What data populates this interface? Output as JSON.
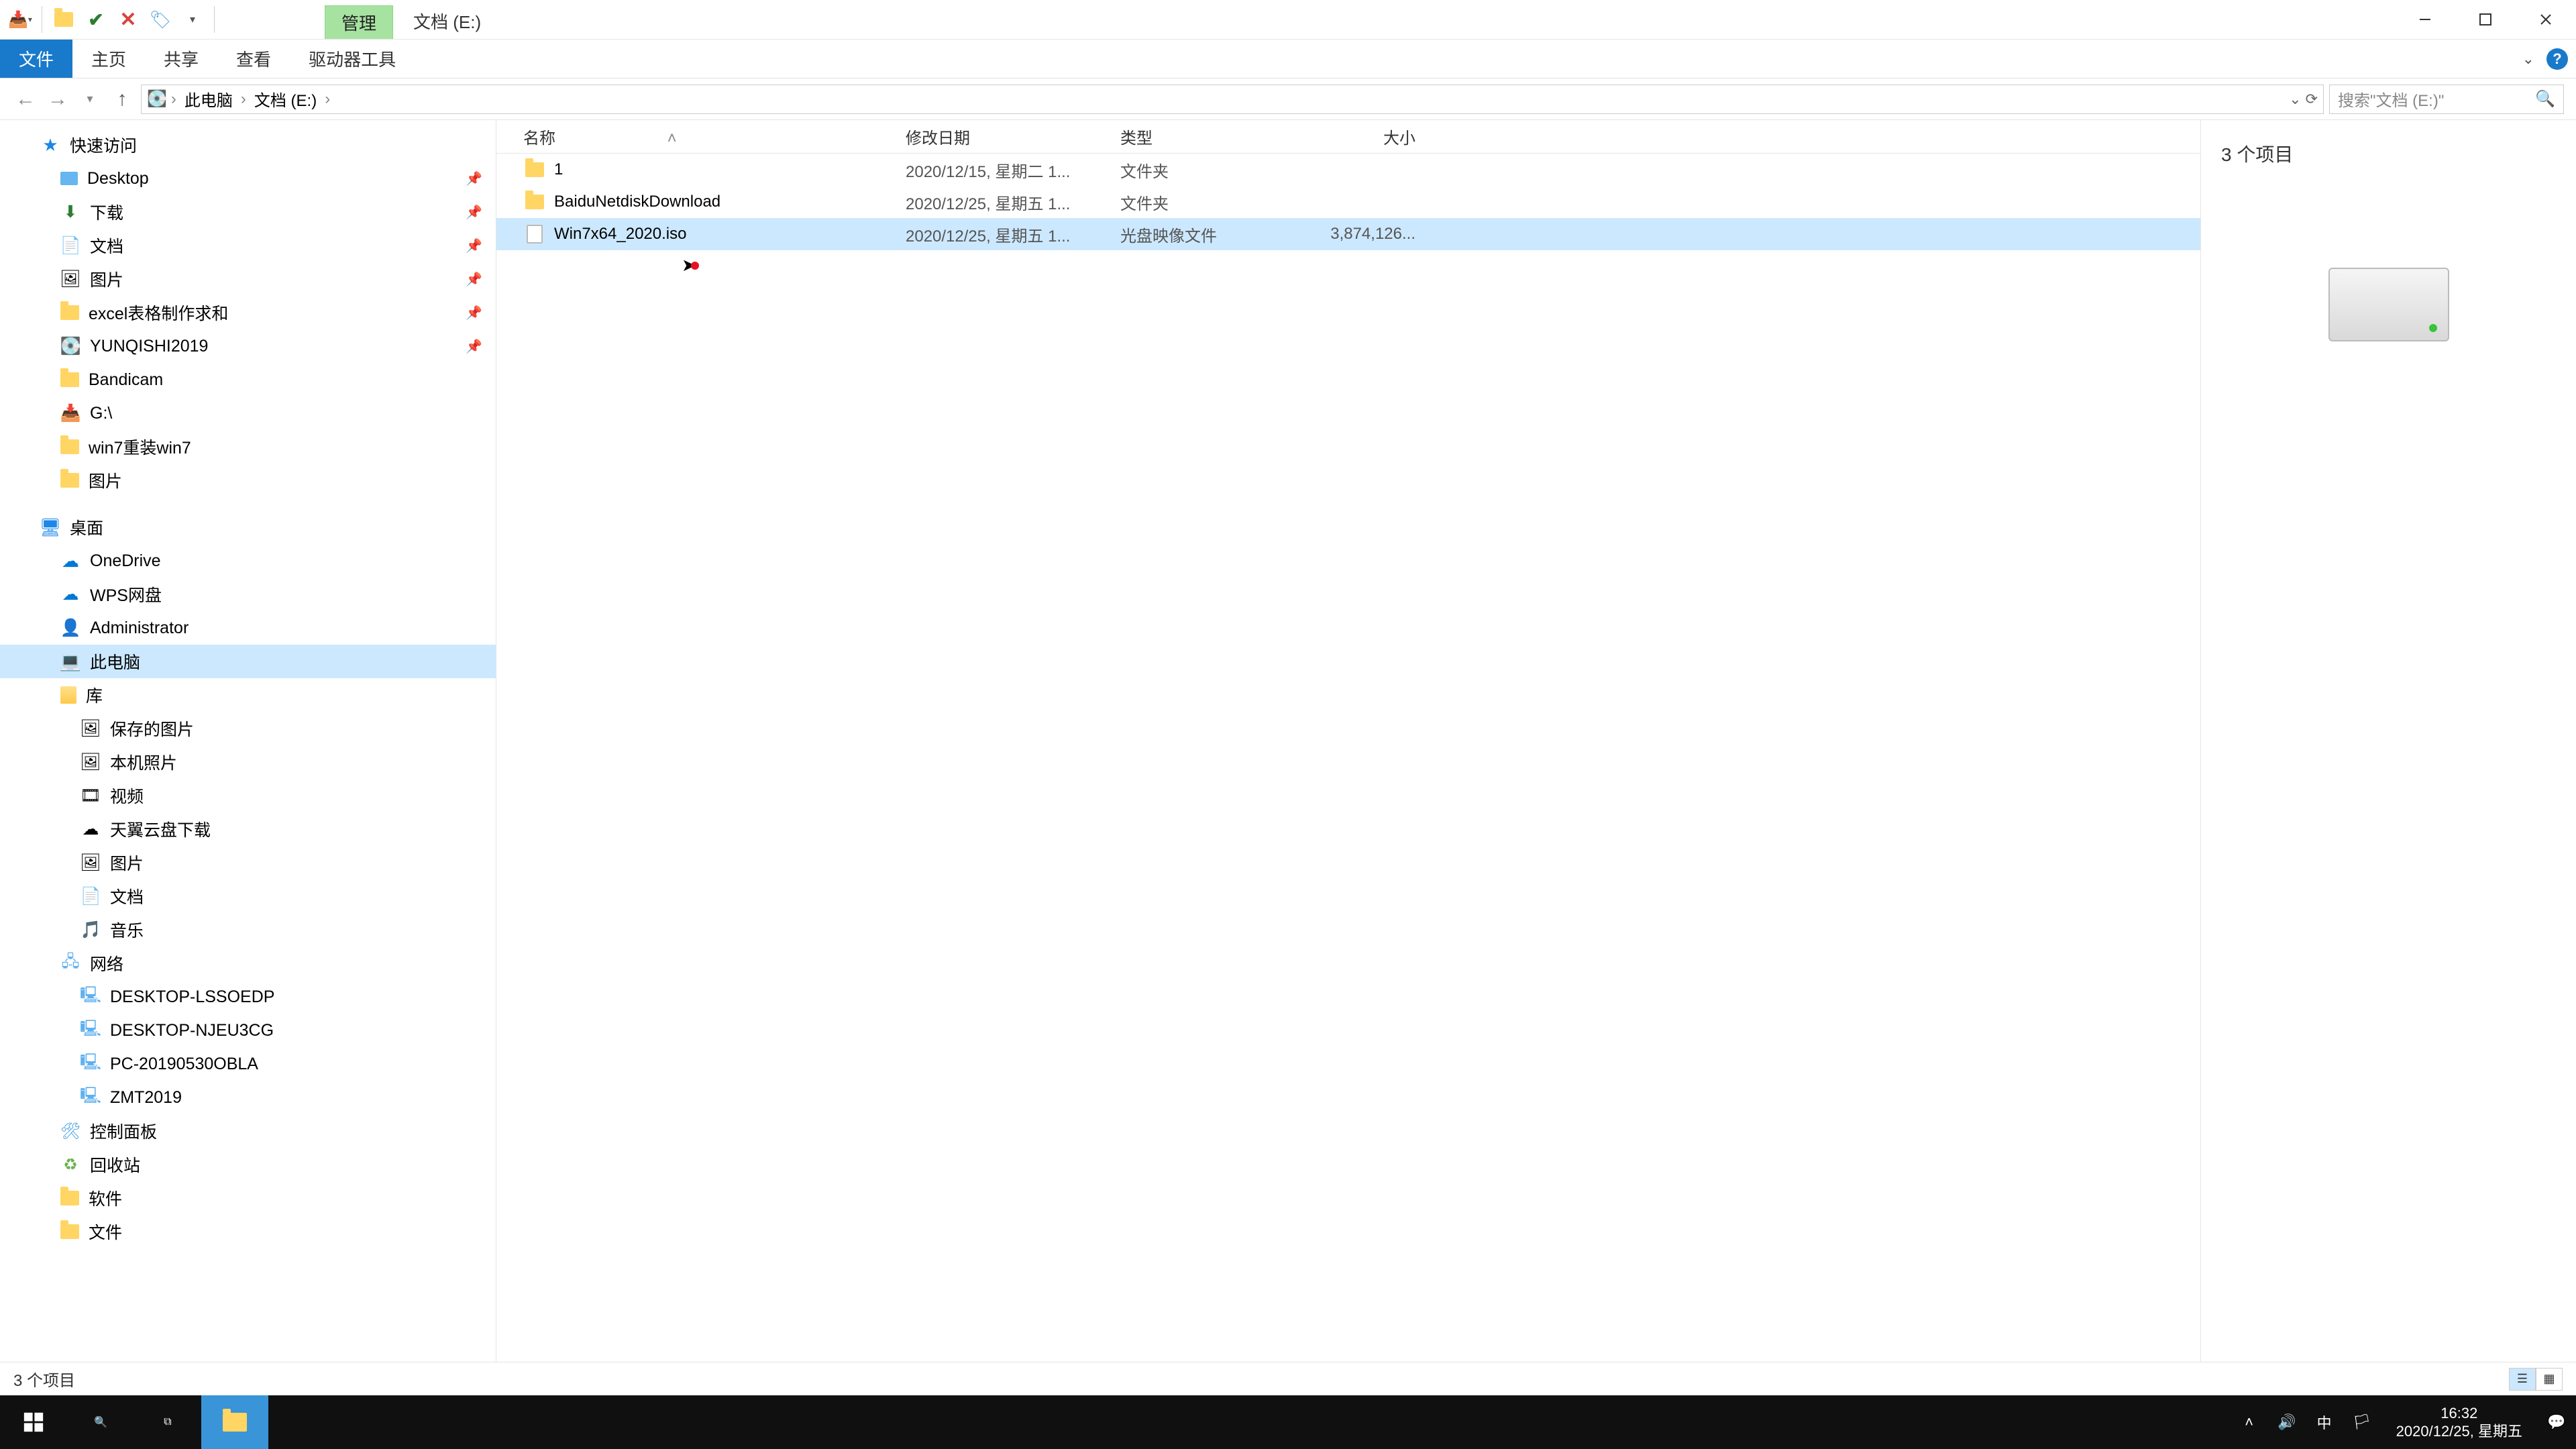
{
  "title": {
    "ribbon_context": "管理",
    "window": "文档 (E:)"
  },
  "ribbon": {
    "file": "文件",
    "home": "主页",
    "share": "共享",
    "view": "查看",
    "drive_tools": "驱动器工具"
  },
  "breadcrumbs": {
    "b0": "此电脑",
    "b1": "文档 (E:)"
  },
  "search": {
    "placeholder": "搜索\"文档 (E:)\""
  },
  "columns": {
    "name": "名称",
    "date": "修改日期",
    "type": "类型",
    "size": "大小"
  },
  "files": [
    {
      "name": "1",
      "date": "2020/12/15, 星期二 1...",
      "type": "文件夹",
      "size": "",
      "icon": "folder"
    },
    {
      "name": "BaiduNetdiskDownload",
      "date": "2020/12/25, 星期五 1...",
      "type": "文件夹",
      "size": "",
      "icon": "folder"
    },
    {
      "name": "Win7x64_2020.iso",
      "date": "2020/12/25, 星期五 1...",
      "type": "光盘映像文件",
      "size": "3,874,126...",
      "icon": "iso",
      "selected": true
    }
  ],
  "tree": {
    "quick_access": "快速访问",
    "qa": {
      "desktop": "Desktop",
      "downloads": "下载",
      "documents": "文档",
      "pictures": "图片",
      "excel": "excel表格制作求和",
      "yunqishi": "YUNQISHI2019",
      "bandicam": "Bandicam",
      "g": "G:\\",
      "win7reinstall": "win7重装win7",
      "pictures2": "图片"
    },
    "desktop_root": "桌面",
    "dr": {
      "onedrive": "OneDrive",
      "wps": "WPS网盘",
      "admin": "Administrator",
      "thispc": "此电脑",
      "libraries": "库",
      "lib": {
        "saved": "保存的图片",
        "camera": "本机照片",
        "videos": "视频",
        "tianyi": "天翼云盘下载",
        "pictures": "图片",
        "docs": "文档",
        "music": "音乐"
      },
      "network": "网络",
      "net": {
        "n1": "DESKTOP-LSSOEDP",
        "n2": "DESKTOP-NJEU3CG",
        "n3": "PC-20190530OBLA",
        "n4": "ZMT2019"
      },
      "control": "控制面板",
      "recycle": "回收站",
      "soft": "软件",
      "files": "文件"
    }
  },
  "preview": {
    "title": "3 个项目"
  },
  "status": {
    "text": "3 个项目"
  },
  "taskbar": {
    "time": "16:32",
    "date": "2020/12/25, 星期五",
    "ime": "中"
  }
}
